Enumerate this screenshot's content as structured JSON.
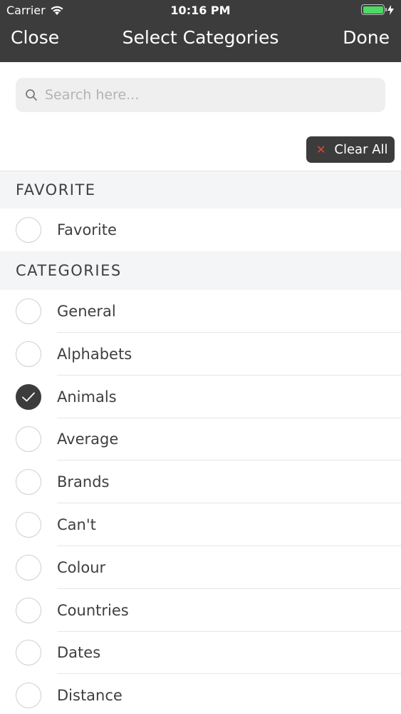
{
  "status_bar": {
    "carrier": "Carrier",
    "time": "10:16 PM",
    "battery_level": 1.0
  },
  "nav": {
    "left_label": "Close",
    "title": "Select Categories",
    "right_label": "Done"
  },
  "search": {
    "placeholder": "Search here...",
    "value": ""
  },
  "clear_all": {
    "icon": "close-icon",
    "label": "Clear All"
  },
  "sections": [
    {
      "header": "FAVORITE",
      "items": [
        {
          "label": "Favorite",
          "checked": false
        }
      ]
    },
    {
      "header": "CATEGORIES",
      "items": [
        {
          "label": "General",
          "checked": false
        },
        {
          "label": "Alphabets",
          "checked": false
        },
        {
          "label": "Animals",
          "checked": true
        },
        {
          "label": "Average",
          "checked": false
        },
        {
          "label": "Brands",
          "checked": false
        },
        {
          "label": "Can't",
          "checked": false
        },
        {
          "label": "Colour",
          "checked": false
        },
        {
          "label": "Countries",
          "checked": false
        },
        {
          "label": "Dates",
          "checked": false
        },
        {
          "label": "Distance",
          "checked": false
        }
      ]
    }
  ],
  "colors": {
    "bar": "#3c3c3c",
    "accent_x": "#e0463f",
    "section_bg": "#f4f5f6",
    "battery": "#4cd964"
  }
}
